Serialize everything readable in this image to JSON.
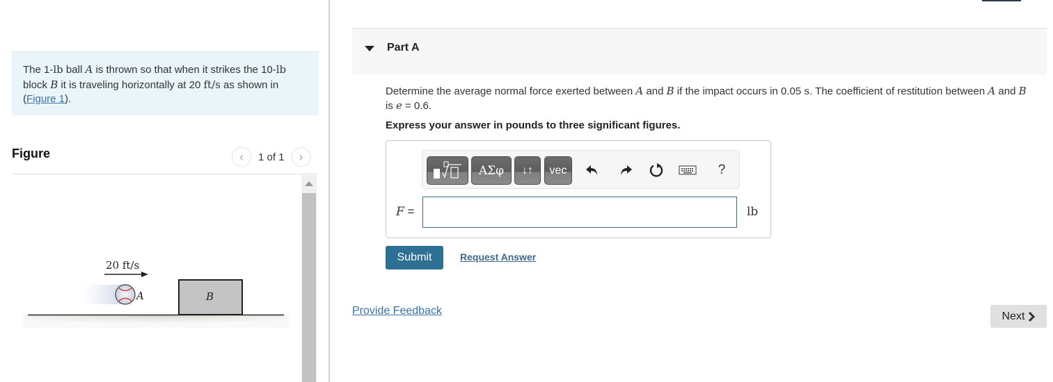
{
  "problem": {
    "parts": [
      {
        "t": "The 1-"
      },
      {
        "t": "lb",
        "cls": "math-up"
      },
      {
        "t": " ball "
      },
      {
        "t": "A",
        "cls": "math"
      },
      {
        "t": " is thrown so that when it strikes the 10-"
      },
      {
        "t": "lb",
        "cls": "math-up"
      },
      {
        "t": " block "
      },
      {
        "t": "B",
        "cls": "math"
      },
      {
        "t": " it is traveling horizontally at 20 "
      },
      {
        "t": "ft/s",
        "cls": "math-up"
      },
      {
        "t": " as shown in ("
      }
    ],
    "figure_link": "Figure 1",
    "after_link": ")."
  },
  "figure": {
    "title": "Figure",
    "pager": "1 of 1",
    "prev_icon": "chevron-left-icon",
    "next_icon": "chevron-right-icon",
    "velocity_label": "20 ft/s",
    "ball_label": "A",
    "block_label": "B"
  },
  "part": {
    "label": "Part A",
    "question": [
      {
        "t": "Determine the average normal force exerted between "
      },
      {
        "t": "A",
        "cls": "math"
      },
      {
        "t": " and "
      },
      {
        "t": "B",
        "cls": "math"
      },
      {
        "t": " if the impact occurs in 0.05 "
      },
      {
        "t": "s",
        "cls": "math-up"
      },
      {
        "t": ". The coefficient of restitution between "
      },
      {
        "t": "A",
        "cls": "math"
      },
      {
        "t": " and "
      },
      {
        "t": "B",
        "cls": "math"
      },
      {
        "t": " is "
      },
      {
        "t": "e",
        "cls": "math"
      },
      {
        "t": " = 0.6."
      }
    ],
    "instruction": "Express your answer in pounds to three significant figures."
  },
  "toolbar": {
    "greek_label": "ΑΣφ",
    "arrows_label": "↓↑",
    "vec_label": "vec",
    "help_label": "?"
  },
  "answer": {
    "variable": "F",
    "equals": " =",
    "value": "",
    "unit": "lb"
  },
  "actions": {
    "submit": "Submit",
    "request_answer": "Request Answer",
    "provide_feedback": "Provide Feedback",
    "next": "Next"
  }
}
